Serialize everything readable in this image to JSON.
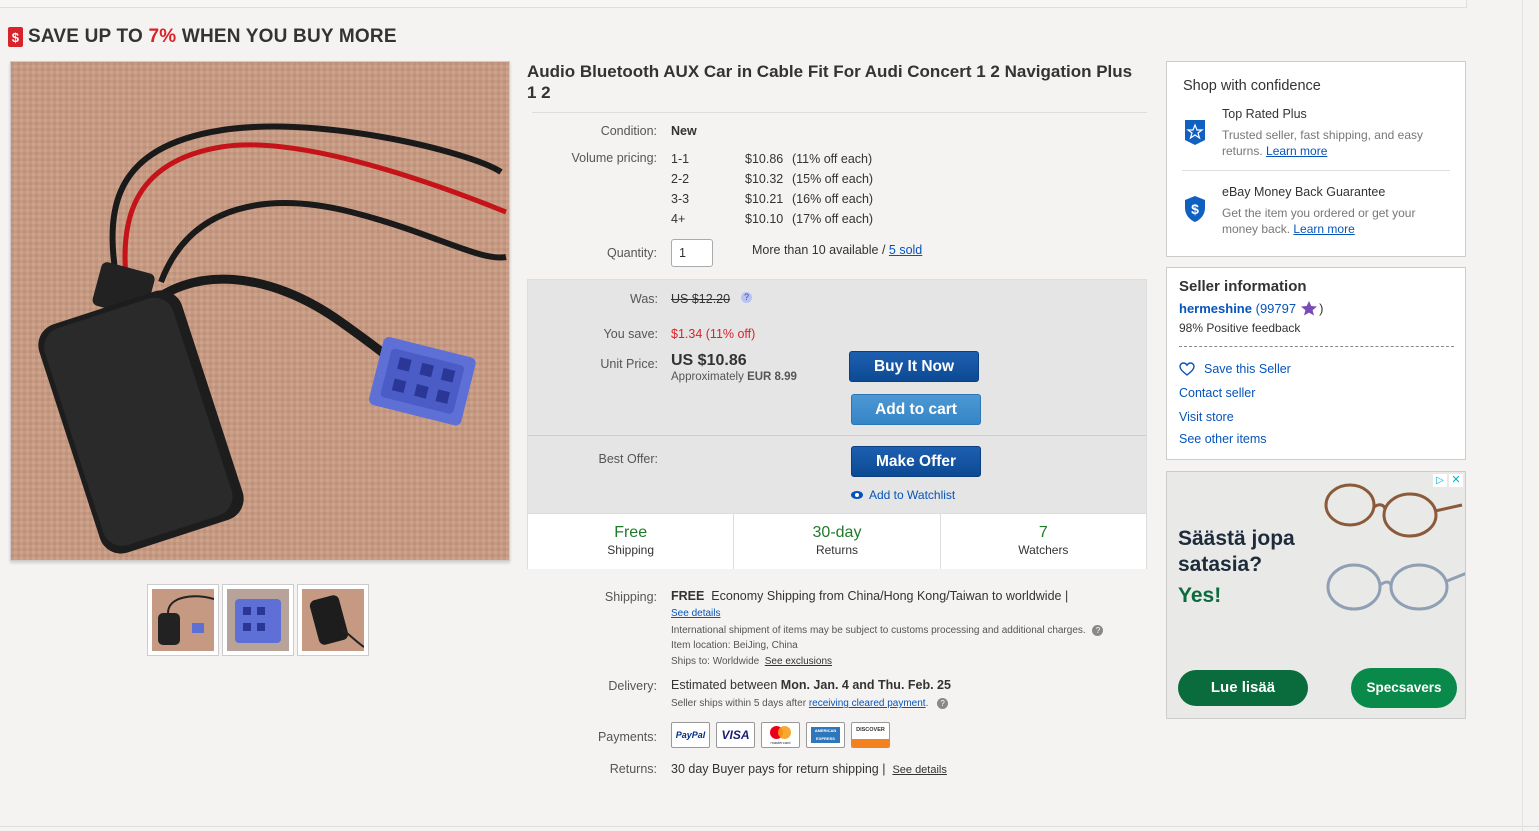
{
  "banner": {
    "prefix": "SAVE UP TO ",
    "percent": "7%",
    "suffix": " WHEN YOU BUY MORE",
    "tag_icon": "$"
  },
  "item": {
    "title": "Audio Bluetooth AUX Car in Cable Fit For Audi Concert 1 2 Navigation Plus 1 2",
    "condition_label": "Condition:",
    "condition": "New",
    "volume_label": "Volume pricing:",
    "volume": [
      {
        "qty": "1-1",
        "price": "$10.86",
        "off": "(11% off each)"
      },
      {
        "qty": "2-2",
        "price": "$10.32",
        "off": "(15% off each)"
      },
      {
        "qty": "3-3",
        "price": "$10.21",
        "off": "(16% off each)"
      },
      {
        "qty": "4+",
        "price": "$10.10",
        "off": "(17% off each)"
      }
    ],
    "quantity_label": "Quantity:",
    "quantity_value": "1",
    "availability": "More than 10 available / ",
    "sold": "5 sold"
  },
  "price": {
    "was_label": "Was:",
    "was": "US $12.20",
    "save_label": "You save:",
    "save": "$1.34 (11% off)",
    "unit_label": "Unit Price:",
    "unit": "US $10.86",
    "approx_prefix": "Approximately ",
    "approx": "EUR 8.99",
    "buy_now": "Buy It Now",
    "add_to_cart": "Add to cart",
    "offer_label": "Best Offer:",
    "make_offer": "Make Offer",
    "watchlist": "Add to Watchlist"
  },
  "strip": [
    {
      "top": "Free",
      "bottom": "Shipping"
    },
    {
      "top": "30-day",
      "bottom": "Returns"
    },
    {
      "top": "7",
      "bottom": "Watchers"
    }
  ],
  "shipping": {
    "label": "Shipping:",
    "free": "FREE",
    "text": "Economy Shipping from China/Hong Kong/Taiwan to worldwide |",
    "see_details": "See details",
    "intl": "International shipment of items may be subject to customs processing and additional charges.",
    "location": "Item location:  BeiJing, China",
    "ships_to": "Ships to:  Worldwide",
    "exclusions": "See exclusions"
  },
  "delivery": {
    "label": "Delivery:",
    "prefix": "Estimated between ",
    "dates": "Mon. Jan. 4 and Thu. Feb. 25",
    "note_prefix": "Seller ships within 5 days after ",
    "note_link": "receiving cleared payment",
    "note_suffix": "."
  },
  "payments": {
    "label": "Payments:",
    "methods": [
      "PayPal",
      "VISA",
      "mastercard",
      "AMERICAN EXPRESS",
      "DISCOVER"
    ]
  },
  "returns": {
    "label": "Returns:",
    "text": "30 day Buyer pays for return shipping |",
    "see_details": "See details"
  },
  "confidence": {
    "title": "Shop with confidence",
    "items": [
      {
        "icon": "star-badge-icon",
        "title": "Top Rated Plus",
        "desc": "Trusted seller, fast shipping, and easy returns. ",
        "link": "Learn more"
      },
      {
        "icon": "shield-dollar-icon",
        "title": "eBay Money Back Guarantee",
        "desc": "Get the item you ordered or get your money back. ",
        "link": "Learn more"
      }
    ]
  },
  "seller": {
    "title": "Seller information",
    "name": "hermeshine",
    "score": "(99797",
    "close": ")",
    "feedback": "98% Positive feedback",
    "save": "Save this Seller",
    "contact": "Contact seller",
    "visit": "Visit store",
    "other": "See other items"
  },
  "ad": {
    "line1": "Säästä jopa",
    "line2": "satasia?",
    "yes": "Yes!",
    "cta": "Lue lisää",
    "brand": "Specsavers"
  },
  "colors": {
    "brand_blue": "#0654ba",
    "button_blue": "#0d4a94",
    "sale_red": "#d8232a",
    "green": "#1f7b2a",
    "ad_green": "#0a6b3c"
  }
}
